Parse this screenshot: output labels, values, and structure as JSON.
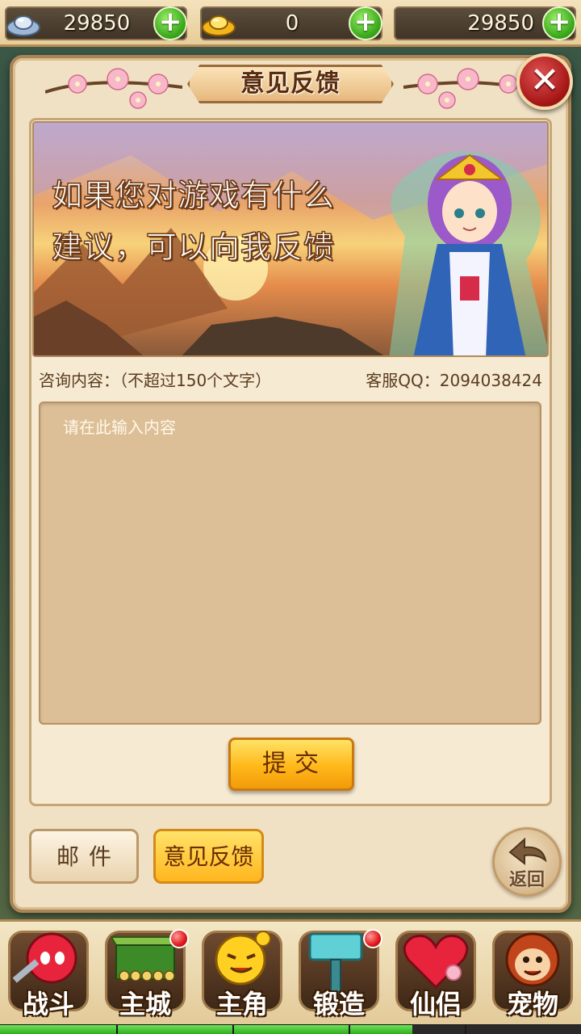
{
  "currencies": [
    {
      "icon": "silver-ingot-icon",
      "value": "29850"
    },
    {
      "icon": "gold-ingot-icon",
      "value": "0"
    },
    {
      "icon": "none",
      "value": "29850"
    }
  ],
  "dialog": {
    "title": "意见反馈",
    "close_icon": "close-x-icon"
  },
  "banner": {
    "line1": "如果您对游戏有什么",
    "line2": "建议，可以向我反馈"
  },
  "form": {
    "content_label": "咨询内容：（不超过150个文字）",
    "service_qq": "客服QQ：2094038424",
    "placeholder": "请在此输入内容",
    "submit_label": "提交"
  },
  "tabs": {
    "mail": "邮件",
    "feedback": "意见反馈"
  },
  "back": {
    "label": "返回",
    "icon": "back-arrow-icon"
  },
  "nav": [
    {
      "key": "battle",
      "label": "战斗",
      "icon": "red-ninja-icon",
      "badge": false
    },
    {
      "key": "city",
      "label": "主城",
      "icon": "green-gate-icon",
      "badge": true
    },
    {
      "key": "hero",
      "label": "主角",
      "icon": "yellow-face-icon",
      "badge": false
    },
    {
      "key": "forge",
      "label": "锻造",
      "icon": "hammer-icon",
      "badge": true
    },
    {
      "key": "partner",
      "label": "仙侣",
      "icon": "heart-icon",
      "badge": false
    },
    {
      "key": "pet",
      "label": "宠物",
      "icon": "monkey-icon",
      "badge": false
    }
  ],
  "colors": {
    "accent_orange": "#ffb819",
    "panel_bg": "#f0e1c5",
    "plus_green": "#3fae1f",
    "close_red": "#a81818"
  },
  "exp_progress": 0.71
}
